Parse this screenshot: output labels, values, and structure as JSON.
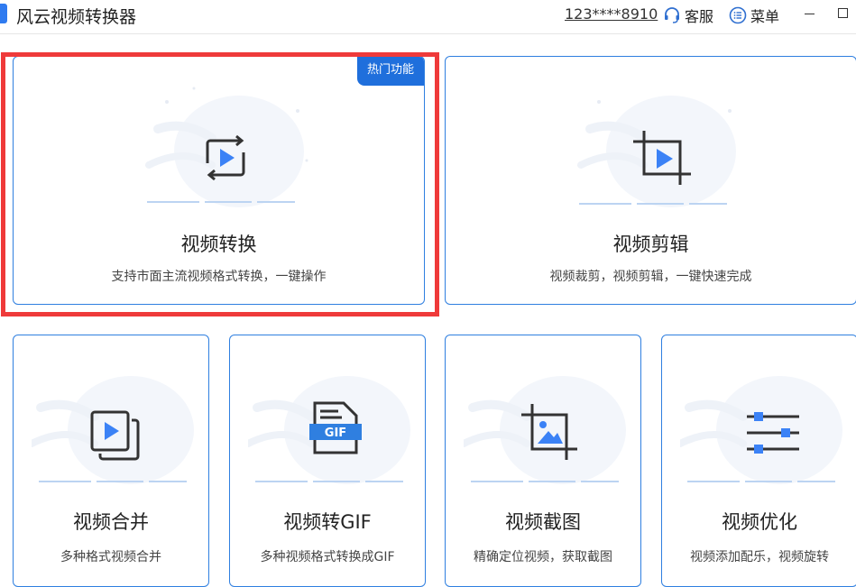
{
  "app": {
    "title": "风云视频转换器",
    "account": "123****8910",
    "service_label": "客服",
    "menu_label": "菜单"
  },
  "colors": {
    "accent": "#2f7fe0",
    "icon_blue": "#3b82f6",
    "highlight": "#ef3a3a",
    "badge": "#1f6fdc"
  },
  "features": {
    "convert": {
      "title": "视频转换",
      "desc": "支持市面主流视频格式转换，一键操作",
      "badge": "热门功能",
      "icon": "video-convert-icon"
    },
    "edit": {
      "title": "视频剪辑",
      "desc": "视频裁剪，视频剪辑，一键快速完成",
      "icon": "video-crop-icon"
    },
    "merge": {
      "title": "视频合并",
      "desc": "多种格式视频合并",
      "icon": "video-merge-icon"
    },
    "gif": {
      "title": "视频转GIF",
      "desc": "多种视频格式转换成GIF",
      "icon": "gif-file-icon",
      "icon_text": "GIF"
    },
    "screenshot": {
      "title": "视频截图",
      "desc": "精确定位视频，获取截图",
      "icon": "image-crop-icon"
    },
    "optimize": {
      "title": "视频优化",
      "desc": "视频添加配乐，视频旋转",
      "icon": "sliders-icon"
    }
  }
}
